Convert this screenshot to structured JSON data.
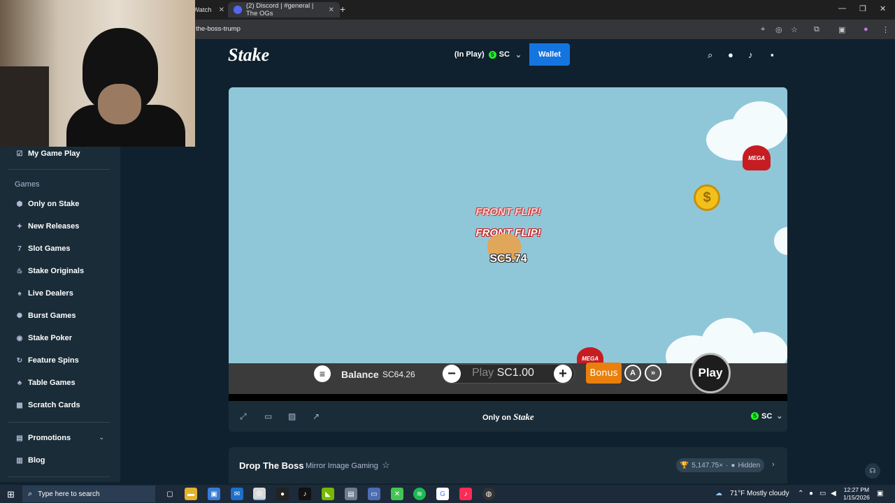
{
  "browser": {
    "tab_partial_label": "Watch",
    "tab_discord_label": "(2) Discord | #general | The OGs",
    "url": "the-boss-trump"
  },
  "header": {
    "logo": "Stake",
    "balance_status": "(In Play)",
    "currency_symbol": "S",
    "currency": "SC",
    "wallet_label": "Wallet"
  },
  "sidebar": {
    "top_item": "My Game Play",
    "section_games": "Games",
    "items": [
      {
        "label": "Only on Stake",
        "icon": "stake-icon"
      },
      {
        "label": "New Releases",
        "icon": "sparkle-icon"
      },
      {
        "label": "Slot Games",
        "icon": "slot-icon"
      },
      {
        "label": "Stake Originals",
        "icon": "flame-icon"
      },
      {
        "label": "Live Dealers",
        "icon": "cards-icon"
      },
      {
        "label": "Burst Games",
        "icon": "burst-icon"
      },
      {
        "label": "Stake Poker",
        "icon": "chip-icon"
      },
      {
        "label": "Feature Spins",
        "icon": "spin-icon"
      },
      {
        "label": "Table Games",
        "icon": "table-icon"
      },
      {
        "label": "Scratch Cards",
        "icon": "grid-icon"
      }
    ],
    "promotions": "Promotions",
    "blog": "Blog"
  },
  "game": {
    "hat_label": "MEGA",
    "coin_glyph": "$",
    "flip_text_1": "FRONT FLIP!",
    "flip_text_2": "FRONT FLIP!",
    "multiplier": "SC5.74",
    "controls": {
      "balance_label": "Balance",
      "balance_value": "SC64.26",
      "bet_prefix": "Play",
      "bet_value": "SC1.00",
      "bonus_label": "Bonus",
      "auto_label": "A",
      "play_label": "Play"
    }
  },
  "game_footer": {
    "only_on_prefix": "Only on",
    "only_on_brand": "Stake",
    "currency": "SC"
  },
  "game_info": {
    "title": "Drop The Boss",
    "provider": "Mirror Image Gaming",
    "max_win": "5,147.75×",
    "visibility": "Hidden"
  },
  "taskbar": {
    "search_placeholder": "Type here to search",
    "weather": "71°F  Mostly cloudy",
    "time": "12:27 PM",
    "date": "1/15/2026"
  },
  "colors": {
    "page_bg": "#0f212e",
    "sidebar_bg": "#1a2c38",
    "wallet_blue": "#1475e1",
    "sc_green": "#1fff20",
    "game_sky": "#8fc7d9",
    "bonus_orange": "#e9800d"
  }
}
